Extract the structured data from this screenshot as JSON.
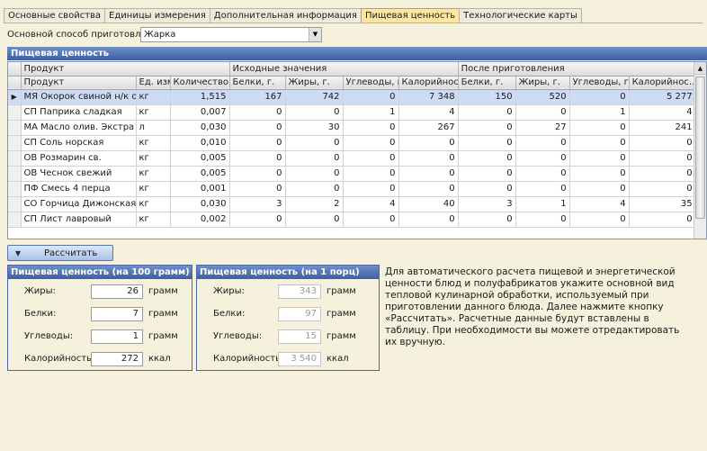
{
  "tabs": [
    {
      "label": "Основные свойства",
      "active": false
    },
    {
      "label": "Единицы измерения",
      "active": false
    },
    {
      "label": "Дополнительная информация",
      "active": false
    },
    {
      "label": "Пищевая ценность",
      "active": true
    },
    {
      "label": "Технологические карты",
      "active": false
    }
  ],
  "method": {
    "label": "Основной способ приготовления:",
    "value": "Жарка"
  },
  "panel_title": "Пищевая ценность",
  "grid": {
    "group_headers": {
      "product": "Продукт",
      "initial": "Исходные значения",
      "after": "После приготовления"
    },
    "columns": [
      "Продукт",
      "Ед. изм.",
      "Количество…",
      "Белки, г.",
      "Жиры, г.",
      "Углеводы, г.",
      "Калорийност…",
      "Белки, г.",
      "Жиры, г.",
      "Углеводы, г.",
      "Калорийнос…"
    ],
    "rows": [
      [
        "МЯ Окорок свиной н/к охл.",
        "кг",
        "1,515",
        "167",
        "742",
        "0",
        "7 348",
        "150",
        "520",
        "0",
        "5 277"
      ],
      [
        "СП Паприка сладкая",
        "кг",
        "0,007",
        "0",
        "0",
        "1",
        "4",
        "0",
        "0",
        "1",
        "4"
      ],
      [
        "МА Масло олив. Экстра",
        "л",
        "0,030",
        "0",
        "30",
        "0",
        "267",
        "0",
        "27",
        "0",
        "241"
      ],
      [
        "СП Соль норская",
        "кг",
        "0,010",
        "0",
        "0",
        "0",
        "0",
        "0",
        "0",
        "0",
        "0"
      ],
      [
        "ОВ Розмарин св.",
        "кг",
        "0,005",
        "0",
        "0",
        "0",
        "0",
        "0",
        "0",
        "0",
        "0"
      ],
      [
        "ОВ Чеснок свежий",
        "кг",
        "0,005",
        "0",
        "0",
        "0",
        "0",
        "0",
        "0",
        "0",
        "0"
      ],
      [
        "ПФ Смесь 4 перца",
        "кг",
        "0,001",
        "0",
        "0",
        "0",
        "0",
        "0",
        "0",
        "0",
        "0"
      ],
      [
        "СО Горчица Дижонская",
        "кг",
        "0,030",
        "3",
        "2",
        "4",
        "40",
        "3",
        "1",
        "4",
        "35"
      ],
      [
        "СП Лист лавровый",
        "кг",
        "0,002",
        "0",
        "0",
        "0",
        "0",
        "0",
        "0",
        "0",
        "0"
      ]
    ],
    "selected_row": 0
  },
  "calc_button": "Рассчитать",
  "per100": {
    "title": "Пищевая ценность (на 100 грамм)",
    "fields": [
      {
        "label": "Жиры:",
        "value": "26",
        "unit": "грамм"
      },
      {
        "label": "Белки:",
        "value": "7",
        "unit": "грамм"
      },
      {
        "label": "Углеводы:",
        "value": "1",
        "unit": "грамм"
      },
      {
        "label": "Калорийность:",
        "value": "272",
        "unit": "ккал"
      }
    ]
  },
  "per_portion": {
    "title": "Пищевая ценность (на 1 порц)",
    "fields": [
      {
        "label": "Жиры:",
        "value": "343",
        "unit": "грамм"
      },
      {
        "label": "Белки:",
        "value": "97",
        "unit": "грамм"
      },
      {
        "label": "Углеводы:",
        "value": "15",
        "unit": "грамм"
      },
      {
        "label": "Калорийность:",
        "value": "3 540",
        "unit": "ккал"
      }
    ]
  },
  "description": "Для автоматического расчета пищевой и энергетической ценности блюд и полуфабрикатов укажите основной вид тепловой кулинарной обработки, используемый при приготовлении данного блюда. Далее нажмите кнопку «Рассчитать». Расчетные данные будут вставлены в таблицу. При необходимости вы можете отредактировать их вручную."
}
